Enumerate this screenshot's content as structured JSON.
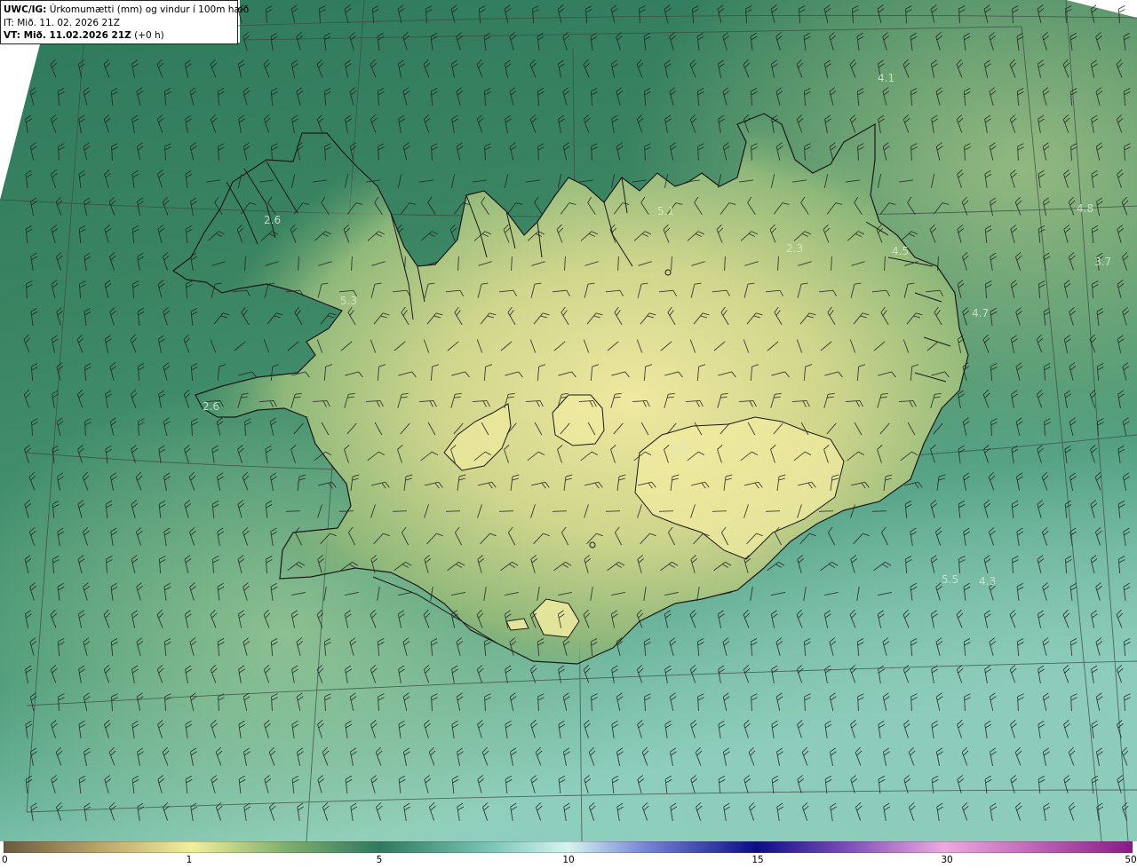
{
  "header": {
    "model": "UWC/IG:",
    "product": " Úrkomumætti (mm) og vindur í 100m hæð",
    "it_prefix": "IT:",
    "it_value": " Mið. 11. 02. 2026 21Z",
    "vt_prefix": "VT: Mið. 11.02.2026 21Z",
    "vt_lead": " (+0 h)"
  },
  "colorbar": {
    "labels": [
      "0",
      "1",
      "5",
      "10",
      "15",
      "30",
      "50",
      ""
    ],
    "label_values": [
      0,
      1,
      5,
      10,
      15,
      30,
      50
    ],
    "stops": [
      {
        "v": 0,
        "color": "#6b5a3e"
      },
      {
        "v": 0.5,
        "color": "#b8a36a"
      },
      {
        "v": 1,
        "color": "#f2ee9a"
      },
      {
        "v": 3,
        "color": "#7fae6e"
      },
      {
        "v": 5,
        "color": "#2f7a5e"
      },
      {
        "v": 8,
        "color": "#7cc7b8"
      },
      {
        "v": 10,
        "color": "#d6f4f0"
      },
      {
        "v": 12,
        "color": "#7a86d6"
      },
      {
        "v": 15,
        "color": "#0d0d86"
      },
      {
        "v": 22,
        "color": "#7a4ab8"
      },
      {
        "v": 30,
        "color": "#f0a8e0"
      },
      {
        "v": 50,
        "color": "#8a1a86"
      }
    ]
  },
  "map_values": [
    {
      "text": "4.1"
    },
    {
      "text": "4.8"
    },
    {
      "text": "3.7"
    },
    {
      "text": "4.5"
    },
    {
      "text": "4.7"
    },
    {
      "text": "5.1"
    },
    {
      "text": "2.3"
    },
    {
      "text": "2.6"
    },
    {
      "text": "5.3"
    },
    {
      "text": "2.6"
    },
    {
      "text": "5.5"
    },
    {
      "text": "4.3"
    },
    {
      "text": "1.9"
    },
    {
      "text": "2"
    }
  ],
  "colors": {
    "sea_dark": "#2e7a5c",
    "sea_light": "#9fd8c8",
    "land_low": "#e6e08e",
    "coastline": "#1a1a1a",
    "wind_barb": "#222222"
  }
}
